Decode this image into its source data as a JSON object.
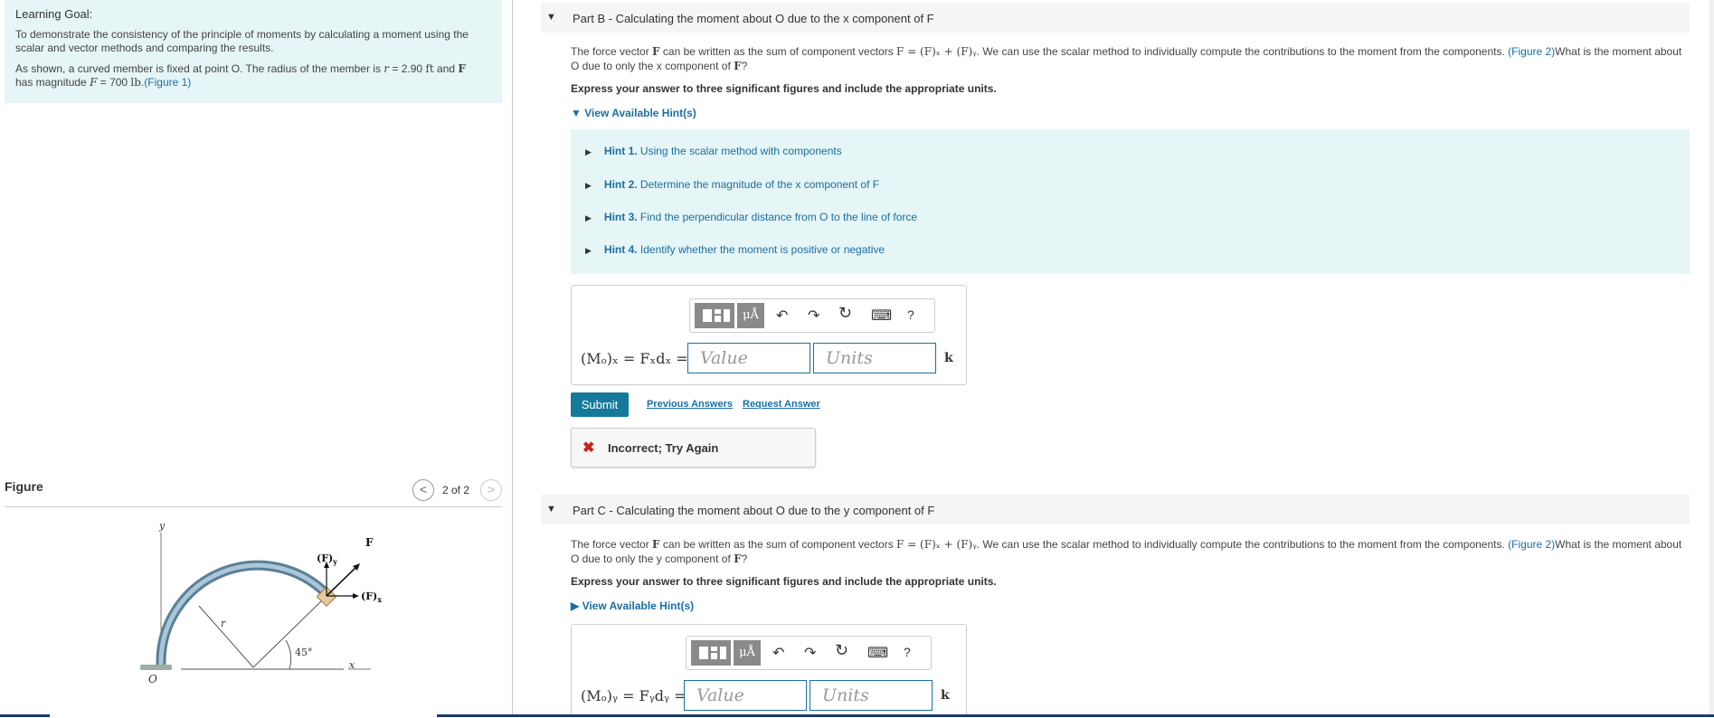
{
  "learning_goal": {
    "title": "Learning Goal:",
    "text": "To demonstrate the consistency of the principle of moments by calculating a moment using the scalar and vector methods and comparing the results.",
    "detail_pre": "As shown, a curved member is fixed at point O. The radius of the member is ",
    "r_sym": "r",
    "r_val": " = 2.90 ",
    "r_unit": "ft",
    "and": " and ",
    "F_sym": "F",
    "detail_mid": " has magnitude ",
    "F_sym2": "F",
    "F_val": " = 700 ",
    "F_unit": "lb",
    "fig_link": ".(Figure 1)"
  },
  "figure": {
    "header": "Figure",
    "nav_prev": "<",
    "nav_text": "2 of 2",
    "nav_next": ">",
    "labels": {
      "y": "y",
      "x": "x",
      "O": "O",
      "r": "r",
      "angle": "45°",
      "F": "F",
      "Fy": "(F)",
      "Fy_sub": "y",
      "Fx": "(F)",
      "Fx_sub": "x"
    }
  },
  "partB": {
    "caret": "▼",
    "title": "Part B - Calculating the moment about O due to the x component of F",
    "para_pre": "The force vector ",
    "F": "F",
    "para_mid": " can be written as the sum of component vectors ",
    "eq": "F = (F)ₓ + (F)ᵧ",
    "para_mid2": ". We can use the scalar method to individually compute the contributions to the moment from the components. ",
    "fig_link": "(Figure 2)",
    "para_post": "What is the moment about O due to only the x component of ",
    "F2": "F",
    "q": "?",
    "express": "Express your answer to three significant figures and include the appropriate units.",
    "hints_toggle": "▼  View Available Hint(s)",
    "hints": [
      {
        "num": "Hint 1.",
        "text": " Using the scalar method with components"
      },
      {
        "num": "Hint 2.",
        "text": " Determine the magnitude of the x component of F"
      },
      {
        "num": "Hint 3.",
        "text": " Find the perpendicular distance from O to the line of force"
      },
      {
        "num": "Hint 4.",
        "text": " Identify whether the moment is positive or negative"
      }
    ],
    "math_label": "(Mₒ)ₓ = Fₓdₓ =",
    "value_placeholder": "Value",
    "units_placeholder": "Units",
    "k": "k",
    "submit": "Submit",
    "previous_answers": "Previous Answers",
    "request_answer": "Request Answer",
    "feedback": "Incorrect; Try Again"
  },
  "partC": {
    "caret": "▼",
    "title": "Part C - Calculating the moment about O due to the y component of F",
    "para_pre": "The force vector ",
    "F": "F",
    "para_mid": " can be written as the sum of component vectors ",
    "eq": "F = (F)ₓ + (F)ᵧ",
    "para_mid2": ". We can use the scalar method to individually compute the contributions to the moment from the components. ",
    "fig_link": "(Figure 2)",
    "para_post": "What is the moment about O due to only the y component of ",
    "F2": "F",
    "q": "?",
    "express": "Express your answer to three significant figures and include the appropriate units.",
    "hints_toggle": "▶  View Available Hint(s)",
    "math_label": "(Mₒ)ᵧ = Fᵧdᵧ =",
    "value_placeholder": "Value",
    "units_placeholder": "Units",
    "k": "k"
  },
  "toolbar": {
    "mu": "μÅ",
    "undo": "↶",
    "redo": "↷",
    "reset": "↻",
    "keyboard": "⌨",
    "help": "?"
  }
}
